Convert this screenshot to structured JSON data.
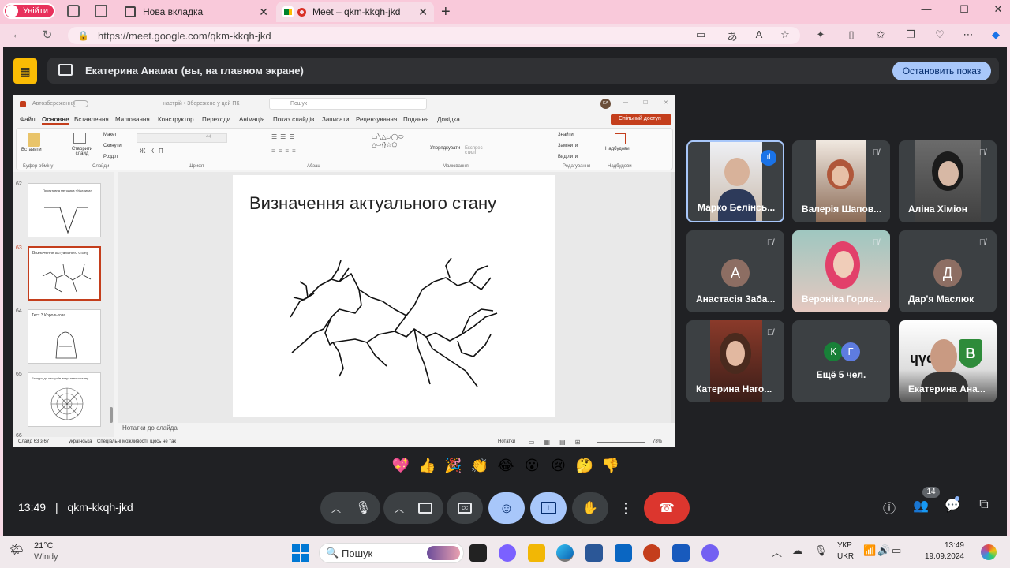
{
  "browser": {
    "profile_label": "Увійти",
    "tabs": [
      {
        "title": "Нова вкладка",
        "icon": "new-tab-icon"
      },
      {
        "title": "Meet – qkm-kkqh-jkd",
        "icon": "meet-record-icon"
      }
    ],
    "url": "https://meet.google.com/qkm-kkqh-jkd"
  },
  "meet": {
    "banner_text": "Екатерина Анамат (вы, на главном экране)",
    "stop_button": "Остановить показ",
    "time": "13:49",
    "separator": "|",
    "meeting_code": "qkm-kkqh-jkd",
    "participants_count": "14",
    "participants": [
      {
        "name": "Марко Белінсь...",
        "speaking": true
      },
      {
        "name": "Валерія Шапов..."
      },
      {
        "name": "Аліна Хіміон"
      },
      {
        "name": "Анастасія Заба...",
        "initial": "А",
        "color": "#8d6e63"
      },
      {
        "name": "Вероніка Горле..."
      },
      {
        "name": "Дар'я Маслюк",
        "initial": "Д",
        "color": "#8d6e63"
      },
      {
        "name": "Катерина Наго..."
      },
      {
        "name": "Ещё 5 чел.",
        "initials": [
          "К",
          "Г"
        ]
      },
      {
        "name": "Екатерина Ана..."
      }
    ],
    "reactions": [
      "💖",
      "👍",
      "🎉",
      "👏",
      "😂",
      "😮",
      "😢",
      "🤔",
      "👎"
    ]
  },
  "ppt": {
    "autosave_label": "Автозбереження",
    "title_text": "настрій • Збережено у цей ПК",
    "search_placeholder": "Пошук",
    "ribbon_tabs": [
      "Файл",
      "Основне",
      "Вставлення",
      "Малювання",
      "Конструктор",
      "Переходи",
      "Анімація",
      "Показ слайдів",
      "Записати",
      "Рецензування",
      "Подання",
      "Довідка"
    ],
    "share_button": "Спільний доступ",
    "ribbon_groups": [
      "Буфер обміну",
      "Слайди",
      "Шрифт",
      "Абзац",
      "Малювання",
      "Редагування",
      "Надбудови"
    ],
    "ribbon_buttons": {
      "paste": "Вставити",
      "new_slide": "Створити слайд",
      "layout": "Макет",
      "reset": "Скинути",
      "section": "Розділ",
      "arrange": "Упорядкувати",
      "quick_styles": "Експрес-стилі",
      "find": "Знайти",
      "replace": "Замінити",
      "select": "Виділити",
      "addins": "Надбудови",
      "font_size": "44"
    },
    "thumbnails": [
      {
        "num": "62",
        "title": "Проективна методика «Ущелина»"
      },
      {
        "num": "63",
        "title": "Визначення актуального стану"
      },
      {
        "num": "64",
        "title": "Тест З.Королькова"
      },
      {
        "num": "65",
        "title": "Екскурс до настроїв актуального стану"
      },
      {
        "num": "66",
        "title": ""
      }
    ],
    "slide_title": "Визначення актуального стану",
    "notes_label": "Нотатки до слайда",
    "status": {
      "slide": "Слайд 63 з 67",
      "language": "українська",
      "accessibility": "Спеціальні можливості: щось не так",
      "notes": "Нотатки",
      "zoom": "78%"
    }
  },
  "taskbar": {
    "temp": "21°C",
    "weather": "Windy",
    "search": "Пошук",
    "lang1": "УКР",
    "lang2": "UKR",
    "clock_time": "13:49",
    "clock_date": "19.09.2024"
  }
}
